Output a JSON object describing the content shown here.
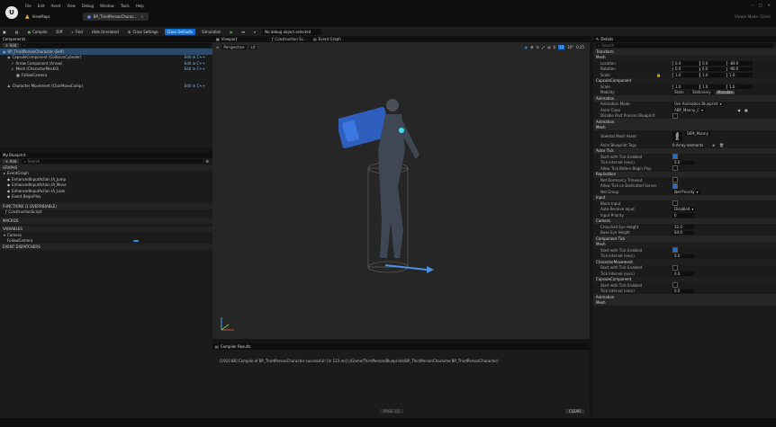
{
  "app": {
    "logo_letter": "U",
    "menu": [
      "File",
      "Edit",
      "Asset",
      "View",
      "Debug",
      "Window",
      "Tools",
      "Help"
    ],
    "project_tab": "ViewMaps",
    "blueprint_tab": "BP_ThirdPersonCharac...",
    "right_status": "Viewer Mode: Client"
  },
  "toolbar": {
    "compile": "Compile",
    "diff": "Diff",
    "find": "Find",
    "hide_unrelated": "Hide Unrelated",
    "class_settings": "Class Settings",
    "class_defaults": "Class Defaults",
    "simulation": "Simulation",
    "debug_filter": "No debug object selected"
  },
  "components": {
    "title": "Components",
    "add_label": "+ Add",
    "root": "BP_ThirdPersonCharacter (Self)",
    "items": [
      {
        "label": "CapsuleComponent (CollisionCylinder)",
        "edit": "Edit in C++"
      },
      {
        "label": "Arrow Component (Arrow)",
        "edit": "Edit in C++"
      },
      {
        "label": "Mesh (CharacterMesh0)",
        "edit": "Edit in C++"
      },
      {
        "label": "FollowCamera",
        "edit": ""
      },
      {
        "label": "Character Movement (CharMoveComp)",
        "edit": "Edit in C++"
      }
    ]
  },
  "my_blueprint": {
    "title": "My Blueprint",
    "add_label": "+ Add",
    "search_placeholder": "Search",
    "graphs_label": "GRAPHS",
    "event_graph": "EventGraph",
    "events": [
      "EnhancedInputAction IA_Jump",
      "EnhancedInputAction IA_Move",
      "EnhancedInputAction IA_Look",
      "Event BeginPlay"
    ],
    "functions_label": "FUNCTIONS (1 OVERRIDABLE)",
    "construction_script": "ConstructionScript",
    "macros_label": "MACROS",
    "variables_label": "VARIABLES",
    "components_label": "Camera",
    "var_item": "FollowCamera",
    "dispatchers_label": "EVENT DISPATCHERS"
  },
  "viewport": {
    "tabs": [
      "Viewport",
      "Construction Sc...",
      "Event Graph"
    ],
    "mode_label": "Perspective",
    "lit_label": "Lit",
    "grid_value": "10",
    "angle_value": "10°",
    "scale_value": "0.25"
  },
  "compiler": {
    "tab": "Compiler Results",
    "message": "[1910.88] Compile of BP_ThirdPersonCharacter successful! [in 123 ms] (/Game/ThirdPerson/Blueprints/BP_ThirdPersonCharacter.BP_ThirdPersonCharacter)",
    "page_label": "PAGE 1/1",
    "clear_label": "CLEAR"
  },
  "details": {
    "title": "Details",
    "search_placeholder": "Search",
    "transform": "Transform",
    "mesh_section": "Mesh",
    "location": {
      "label": "Location",
      "x": "0.0",
      "y": "0.0",
      "z": "-89.0"
    },
    "rotation": {
      "label": "Rotation",
      "x": "0.0",
      "y": "0.0",
      "z": "-90.0"
    },
    "scale": {
      "label": "Scale",
      "x": "1.0",
      "y": "1.0",
      "z": "1.0"
    },
    "capsule_section": "CapsuleComponent",
    "capsule_scale": {
      "label": "Scale",
      "x": "1.0",
      "y": "1.0",
      "z": "1.0"
    },
    "mobility_label": "Mobility",
    "mobility_options": [
      "Static",
      "Stationary",
      "Movable"
    ],
    "animation": "Animation",
    "anim_mode": {
      "label": "Animation Mode",
      "value": "Use Animation Blueprint"
    },
    "anim_class": {
      "label": "Anim Class",
      "value": "ABP_Manny_C"
    },
    "disable_post": "Disable Post Process Blueprint",
    "animation2": "Animation",
    "mesh2": "Mesh",
    "skeletal_mesh": {
      "label": "Skeletal Mesh Asset",
      "value": "SKM_Manny"
    },
    "anim_bp": {
      "label": "Anim Blueprint Tags",
      "value": "0 Array elements"
    },
    "tick": "Actor Tick",
    "tick_rows": [
      {
        "label": "Start with Tick Enabled",
        "on": true
      },
      {
        "label": "Tick Interval (secs)",
        "value": "0.0"
      },
      {
        "label": "Allow Tick Before Begin Play",
        "on": false
      }
    ],
    "replication": "Replication",
    "rep_rows": [
      {
        "label": "Net Dormancy Timeout",
        "on": false
      },
      {
        "label": "Allow Tick on Dedicated Server",
        "on": true
      },
      {
        "label": "Net Group",
        "value": "Net Priority"
      }
    ],
    "input": "Input",
    "input_rows": [
      {
        "label": "Block Input",
        "on": false
      },
      {
        "label": "Auto Receive Input",
        "value": "Disabled"
      },
      {
        "label": "Input Priority",
        "value": "0"
      }
    ],
    "camera": "Camera",
    "camera_rows": [
      {
        "label": "Crouched Eye Height",
        "value": "32.0"
      },
      {
        "label": "Base Eye Height",
        "value": "64.0"
      }
    ],
    "component_tick": "Component Tick",
    "ct_mesh": "Mesh",
    "ct_rows1": [
      {
        "label": "Start with Tick Enabled",
        "on": true
      },
      {
        "label": "Tick Interval (secs)",
        "value": "0.0"
      }
    ],
    "ct_charmove": "CharacterMovement",
    "ct_rows2": [
      {
        "label": "Start with Tick Enabled",
        "on": false
      },
      {
        "label": "Tick Interval (secs)",
        "value": "0.0"
      }
    ],
    "ct_capsule": "CapsuleComponent",
    "ct_rows3": [
      {
        "label": "Start with Tick Enabled",
        "on": false
      },
      {
        "label": "Tick Interval (secs)",
        "value": "0.0"
      }
    ],
    "ct_anim": "Animation",
    "ct_mesh2": "Mesh"
  },
  "colors": {
    "accent": "#0d6fd1",
    "panel": "#1b1b1b",
    "viewport": "#262626",
    "select": "#2b4a6a"
  }
}
